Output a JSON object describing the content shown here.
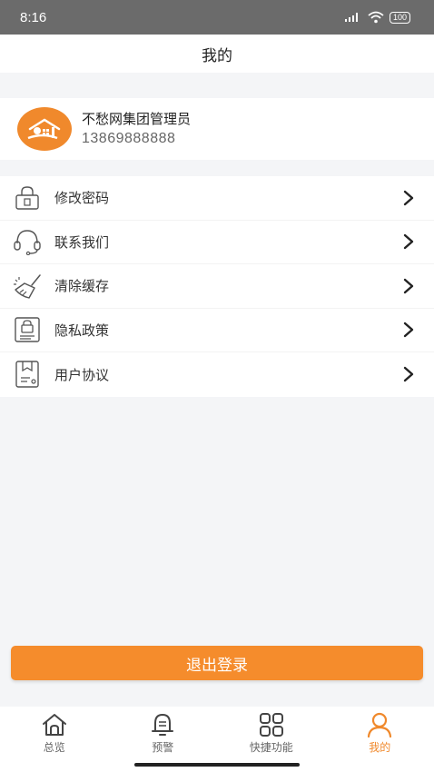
{
  "status_bar": {
    "time": "8:16",
    "battery": "100"
  },
  "header": {
    "title": "我的"
  },
  "profile": {
    "name": "不愁网集团管理员",
    "phone": "13869888888",
    "avatar_color": "#f0892c"
  },
  "menu": {
    "items": [
      {
        "label": "修改密码",
        "icon": "lock-icon"
      },
      {
        "label": "联系我们",
        "icon": "headset-icon"
      },
      {
        "label": "清除缓存",
        "icon": "broom-icon"
      },
      {
        "label": "隐私政策",
        "icon": "privacy-document-icon"
      },
      {
        "label": "用户协议",
        "icon": "agreement-document-icon"
      }
    ]
  },
  "logout": {
    "label": "退出登录"
  },
  "tabbar": {
    "items": [
      {
        "label": "总览",
        "icon": "home-icon"
      },
      {
        "label": "预警",
        "icon": "bell-icon"
      },
      {
        "label": "快捷功能",
        "icon": "grid-icon"
      },
      {
        "label": "我的",
        "icon": "user-icon",
        "active": true
      }
    ]
  },
  "colors": {
    "accent": "#f58c2c",
    "background": "#f4f5f7"
  }
}
